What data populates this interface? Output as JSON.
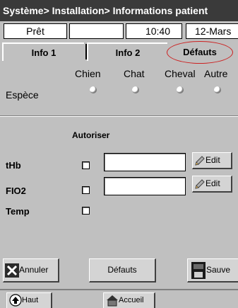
{
  "title": "Système> Installation> Informations patient",
  "status": {
    "state": "Prêt",
    "empty": "",
    "time": "10:40",
    "date": "12-Mars"
  },
  "tabs": [
    {
      "label": "Info 1"
    },
    {
      "label": "Info 2"
    },
    {
      "label": "Défauts",
      "selected": true
    }
  ],
  "species": {
    "row_label": "Espèce",
    "options": [
      "Chien",
      "Chat",
      "Cheval",
      "Autre"
    ]
  },
  "params": {
    "allow_header": "Autoriser",
    "rows": [
      {
        "label": "tHb",
        "value": "",
        "edit_label": "Edit"
      },
      {
        "label": "FIO2",
        "value": "",
        "edit_label": "Edit"
      },
      {
        "label": "Temp"
      }
    ]
  },
  "actions": {
    "cancel": "Annuler",
    "defaults": "Défauts",
    "save": "Sauve"
  },
  "nav": {
    "up": "Haut",
    "home": "Accueil"
  },
  "colors": {
    "title_bar": "#3a3a3a",
    "panel": "#c0c0c0",
    "highlight_circle": "#cc2020"
  }
}
